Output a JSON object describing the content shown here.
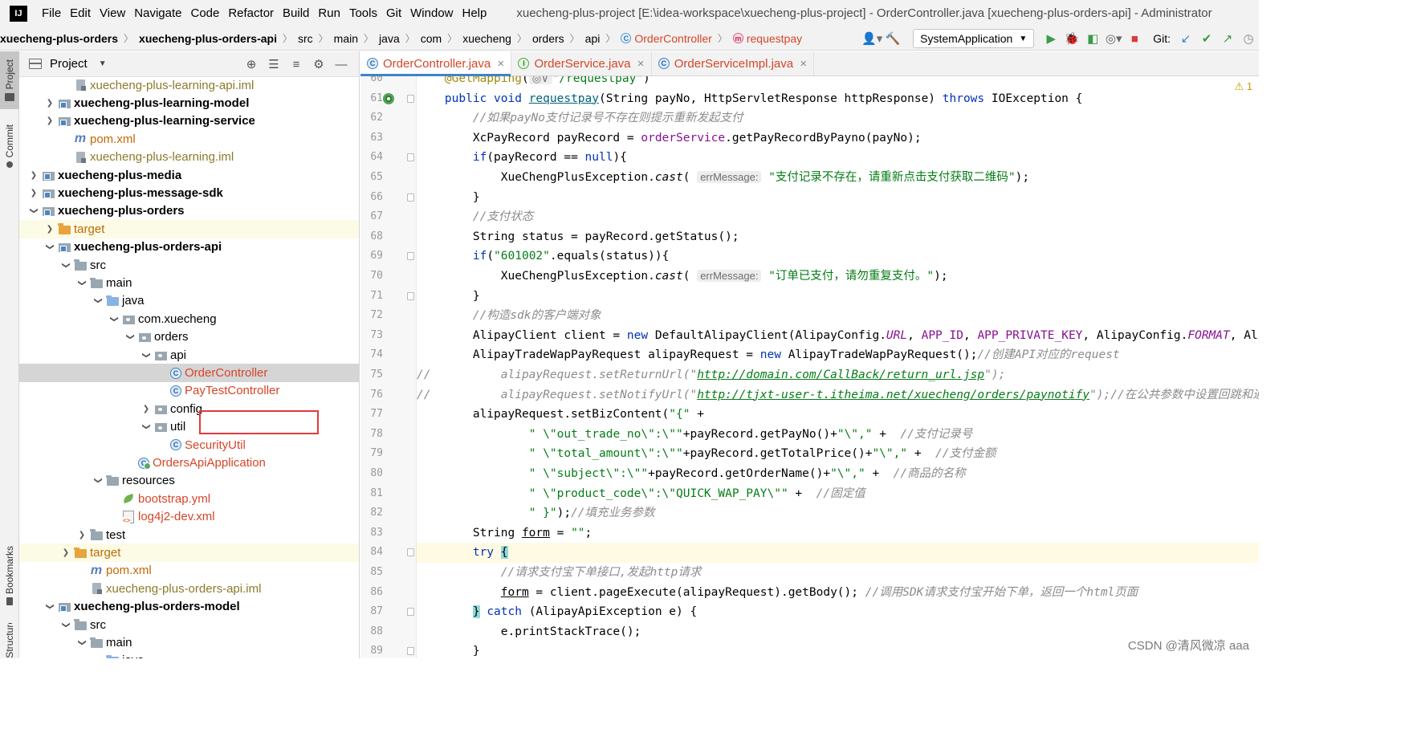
{
  "menubar": {
    "items": [
      "File",
      "Edit",
      "View",
      "Navigate",
      "Code",
      "Refactor",
      "Build",
      "Run",
      "Tools",
      "Git",
      "Window",
      "Help"
    ],
    "title": "xuecheng-plus-project [E:\\idea-workspace\\xuecheng-plus-project] - OrderController.java [xuecheng-plus-orders-api] - Administrator"
  },
  "breadcrumb": [
    "xuecheng-plus-orders",
    "xuecheng-plus-orders-api",
    "src",
    "main",
    "java",
    "com",
    "xuecheng",
    "orders",
    "api",
    "OrderController",
    "requestpay"
  ],
  "toolbar": {
    "run_config": "SystemApplication",
    "git_label": "Git:"
  },
  "side_tabs": {
    "project": "Project",
    "commit": "Commit",
    "bookmarks": "Bookmarks",
    "structure": "Structure"
  },
  "project_panel": {
    "title": "Project",
    "tree": [
      {
        "label": "xuecheng-plus-learning-api.iml",
        "indent": 3,
        "arrow": "",
        "icon": "iml",
        "style": "olive"
      },
      {
        "label": "xuecheng-plus-learning-model",
        "indent": 2,
        "arrow": "right",
        "icon": "module",
        "style": "b"
      },
      {
        "label": "xuecheng-plus-learning-service",
        "indent": 2,
        "arrow": "right",
        "icon": "module",
        "style": "b"
      },
      {
        "label": "pom.xml",
        "indent": 3,
        "arrow": "",
        "icon": "pom",
        "style": "o"
      },
      {
        "label": "xuecheng-plus-learning.iml",
        "indent": 3,
        "arrow": "",
        "icon": "iml",
        "style": "olive"
      },
      {
        "label": "xuecheng-plus-media",
        "indent": 1,
        "arrow": "right",
        "icon": "module",
        "style": "b"
      },
      {
        "label": "xuecheng-plus-message-sdk",
        "indent": 1,
        "arrow": "right",
        "icon": "module",
        "style": "b"
      },
      {
        "label": "xuecheng-plus-orders",
        "indent": 1,
        "arrow": "down",
        "icon": "module",
        "style": "b"
      },
      {
        "label": "target",
        "indent": 2,
        "arrow": "right",
        "icon": "folder-orange",
        "style": "o",
        "hl": true
      },
      {
        "label": "xuecheng-plus-orders-api",
        "indent": 2,
        "arrow": "down",
        "icon": "module",
        "style": "b"
      },
      {
        "label": "src",
        "indent": 3,
        "arrow": "down",
        "icon": "folder",
        "style": ""
      },
      {
        "label": "main",
        "indent": 4,
        "arrow": "down",
        "icon": "folder",
        "style": ""
      },
      {
        "label": "java",
        "indent": 5,
        "arrow": "down",
        "icon": "folder-blue",
        "style": ""
      },
      {
        "label": "com.xuecheng",
        "indent": 6,
        "arrow": "down",
        "icon": "pkg",
        "style": ""
      },
      {
        "label": "orders",
        "indent": 7,
        "arrow": "down",
        "icon": "pkg",
        "style": ""
      },
      {
        "label": "api",
        "indent": 8,
        "arrow": "down",
        "icon": "pkg",
        "style": ""
      },
      {
        "label": "OrderController",
        "indent": 9,
        "arrow": "",
        "icon": "cls",
        "style": "r",
        "sel": true
      },
      {
        "label": "PayTestController",
        "indent": 9,
        "arrow": "",
        "icon": "cls",
        "style": "r"
      },
      {
        "label": "config",
        "indent": 8,
        "arrow": "right",
        "icon": "pkg",
        "style": ""
      },
      {
        "label": "util",
        "indent": 8,
        "arrow": "down",
        "icon": "pkg",
        "style": ""
      },
      {
        "label": "SecurityUtil",
        "indent": 9,
        "arrow": "",
        "icon": "cls",
        "style": "r"
      },
      {
        "label": "OrdersApiApplication",
        "indent": 7,
        "arrow": "",
        "icon": "cls-app",
        "style": "r"
      },
      {
        "label": "resources",
        "indent": 5,
        "arrow": "down",
        "icon": "folder",
        "style": ""
      },
      {
        "label": "bootstrap.yml",
        "indent": 6,
        "arrow": "",
        "icon": "yml",
        "style": "r"
      },
      {
        "label": "log4j2-dev.xml",
        "indent": 6,
        "arrow": "",
        "icon": "xml",
        "style": "r"
      },
      {
        "label": "test",
        "indent": 4,
        "arrow": "right",
        "icon": "folder",
        "style": ""
      },
      {
        "label": "target",
        "indent": 3,
        "arrow": "right",
        "icon": "folder-orange",
        "style": "o",
        "hl": true
      },
      {
        "label": "pom.xml",
        "indent": 4,
        "arrow": "",
        "icon": "pom",
        "style": "o"
      },
      {
        "label": "xuecheng-plus-orders-api.iml",
        "indent": 4,
        "arrow": "",
        "icon": "iml",
        "style": "olive"
      },
      {
        "label": "xuecheng-plus-orders-model",
        "indent": 2,
        "arrow": "down",
        "icon": "module",
        "style": "b"
      },
      {
        "label": "src",
        "indent": 3,
        "arrow": "down",
        "icon": "folder",
        "style": ""
      },
      {
        "label": "main",
        "indent": 4,
        "arrow": "down",
        "icon": "folder",
        "style": ""
      },
      {
        "label": "java",
        "indent": 5,
        "arrow": "",
        "icon": "folder-blue",
        "style": ""
      }
    ]
  },
  "tabs": [
    {
      "label": "OrderController.java",
      "icon": "C",
      "active": true
    },
    {
      "label": "OrderService.java",
      "icon": "I",
      "active": false
    },
    {
      "label": "OrderServiceImpl.java",
      "icon": "C",
      "active": false
    }
  ],
  "editor": {
    "lines": [
      {
        "n": 60,
        "html": "    <span class=\"ann\">@GetMapping</span>(<span class=\"hint\">◎∨</span><span class=\"st\">\"/requestpay\"</span>)"
      },
      {
        "n": 61,
        "run": true,
        "html": "    <span class=\"kw\">public void</span> <span class=\"mc ul\">requestpay</span>(String payNo, HttpServletResponse httpResponse) <span class=\"kw\">throws</span> IOException {"
      },
      {
        "n": 62,
        "html": "        <span class=\"cm\">//如果payNo支付记录号不存在则提示重新发起支付</span>"
      },
      {
        "n": 63,
        "html": "        XcPayRecord payRecord = <span class=\"fd\">orderService</span>.getPayRecordByPayno(payNo);"
      },
      {
        "n": 64,
        "html": "        <span class=\"kw\">if</span>(payRecord == <span class=\"kw\">null</span>){"
      },
      {
        "n": 65,
        "html": "            XueChengPlusException.<span class=\"it\">cast</span>( <span class=\"hint\">errMessage:</span> <span class=\"st\">\"支付记录不存在，请重新点击支付获取二维码\"</span>);"
      },
      {
        "n": 66,
        "html": "        }"
      },
      {
        "n": 67,
        "html": "        <span class=\"cm\">//支付状态</span>"
      },
      {
        "n": 68,
        "html": "        String status = payRecord.getStatus();"
      },
      {
        "n": 69,
        "html": "        <span class=\"kw\">if</span>(<span class=\"st\">\"601002\"</span>.equals(status)){"
      },
      {
        "n": 70,
        "html": "            XueChengPlusException.<span class=\"it\">cast</span>( <span class=\"hint\">errMessage:</span> <span class=\"st\">\"订单已支付，请勿重复支付。\"</span>);"
      },
      {
        "n": 71,
        "html": "        }"
      },
      {
        "n": 72,
        "html": "        <span class=\"cm\">//构造sdk的客户端对象</span>"
      },
      {
        "n": 73,
        "html": "        AlipayClient client = <span class=\"kw\">new</span> DefaultAlipayClient(AlipayConfig.<span class=\"sf\">URL</span>, <span class=\"fd\">APP_ID</span>, <span class=\"fd\">APP_PRIVATE_KEY</span>, AlipayConfig.<span class=\"sf\">FORMAT</span>, AlipayCo"
      },
      {
        "n": 74,
        "html": "        AlipayTradeWapPayRequest alipayRequest = <span class=\"kw\">new</span> AlipayTradeWapPayRequest();<span class=\"cm\">//创建API对应的request</span>"
      },
      {
        "n": 75,
        "html": "<span class=\"cm\">//          alipayRequest.setReturnUrl(\"<span class=\"link\">http://domain.com/CallBack/return_url.jsp</span>\");</span>"
      },
      {
        "n": 76,
        "html": "<span class=\"cm\">//          alipayRequest.setNotifyUrl(\"<span class=\"link\">http://tjxt-user-t.itheima.net/xuecheng/orders/paynotify</span>\");//在公共参数中设置回跳和通知地址</span>"
      },
      {
        "n": 77,
        "html": "        alipayRequest.setBizContent(<span class=\"st\">\"{\"</span> +"
      },
      {
        "n": 78,
        "html": "                <span class=\"st\">\" \\\"out_trade_no\\\":\\\"\"</span>+payRecord.getPayNo()+<span class=\"st\">\"\\\",\"</span> +  <span class=\"cm\">//支付记录号</span>"
      },
      {
        "n": 79,
        "html": "                <span class=\"st\">\" \\\"total_amount\\\":\\\"\"</span>+payRecord.getTotalPrice()+<span class=\"st\">\"\\\",\"</span> +  <span class=\"cm\">//支付金额</span>"
      },
      {
        "n": 80,
        "html": "                <span class=\"st\">\" \\\"subject\\\":\\\"\"</span>+payRecord.getOrderName()+<span class=\"st\">\"\\\",\"</span> +  <span class=\"cm\">//商品的名称</span>"
      },
      {
        "n": 81,
        "html": "                <span class=\"st\">\" \\\"product_code\\\":\\\"QUICK_WAP_PAY\\\"\"</span> +  <span class=\"cm\">//固定值</span>"
      },
      {
        "n": 82,
        "html": "                <span class=\"st\">\" }\"</span>);<span class=\"cm\">//填充业务参数</span>"
      },
      {
        "n": 83,
        "html": "        String <span class=\"ul\">form</span> = <span class=\"st\">\"\"</span>;"
      },
      {
        "n": 84,
        "cur": true,
        "html": "        <span class=\"kw\">try</span> <span class=\"brace-hl\">{</span>"
      },
      {
        "n": 85,
        "html": "            <span class=\"cm\">//请求支付宝下单接口,发起http请求</span>"
      },
      {
        "n": 86,
        "html": "            <span class=\"ul\">form</span> = client.pageExecute(alipayRequest).getBody(); <span class=\"cm\">//调用SDK请求支付宝开始下单，返回一个html页面</span>"
      },
      {
        "n": 87,
        "html": "        <span class=\"brace-hl\">}</span> <span class=\"kw\">catch</span> (AlipayApiException e) {"
      },
      {
        "n": 88,
        "html": "            e.printStackTrace();"
      },
      {
        "n": 89,
        "html": "        }"
      }
    ]
  },
  "warning_count": "1",
  "watermark": "CSDN @清风微凉 aaa"
}
